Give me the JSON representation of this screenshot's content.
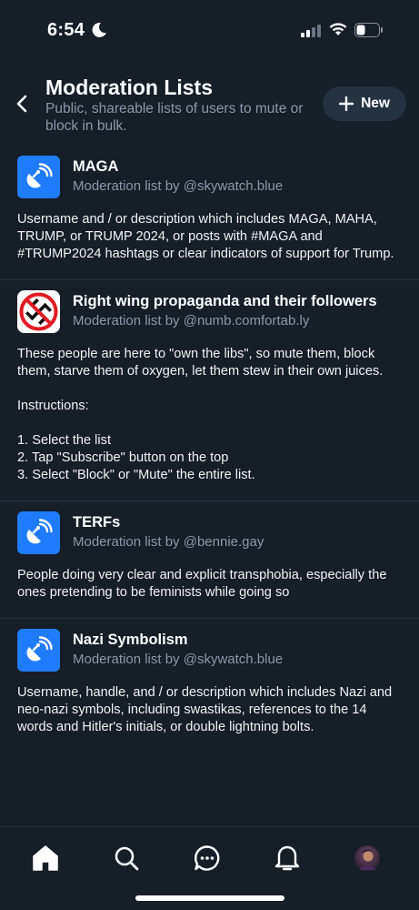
{
  "status_bar": {
    "time": "6:54"
  },
  "header": {
    "title": "Moderation Lists",
    "subtitle": "Public, shareable lists of users to mute or block in bulk.",
    "new_label": "New"
  },
  "lists": [
    {
      "name": "MAGA",
      "by": "Moderation list by @skywatch.blue",
      "description": "Username and / or description which includes MAGA, MAHA, TRUMP, or TRUMP 2024, or posts with #MAGA and #TRUMP2024 hashtags or clear indicators of support for Trump.",
      "avatar": "list-satellite-icon"
    },
    {
      "name": "Right wing propaganda and their followers",
      "by": "Moderation list by @numb.comfortab.ly",
      "description": "These people are here to \"own the libs\", so mute them, block them, starve them of oxygen, let them stew in their own juices.\n\nInstructions:\n\n1. Select the list\n2. Tap \"Subscribe\" button on the top\n3. Select \"Block\" or \"Mute\" the entire list.",
      "avatar": "no-swastika-icon"
    },
    {
      "name": "TERFs",
      "by": "Moderation list by @bennie.gay",
      "description": "People doing very clear and explicit transphobia, especially the ones pretending to be feminists while going so",
      "avatar": "list-satellite-icon"
    },
    {
      "name": "Nazi Symbolism",
      "by": "Moderation list by @skywatch.blue",
      "description": "Username, handle, and / or description which includes Nazi and neo-nazi symbols, including swastikas, references to the 14 words and Hitler's initials, or double lightning bolts.",
      "avatar": "list-satellite-icon"
    }
  ],
  "tab_bar": {
    "tabs": [
      "home-icon",
      "search-icon",
      "chat-icon",
      "bell-icon",
      "profile-avatar"
    ]
  },
  "colors": {
    "background": "#161e27",
    "accent": "#1f7cff",
    "muted": "#8b98a7"
  }
}
